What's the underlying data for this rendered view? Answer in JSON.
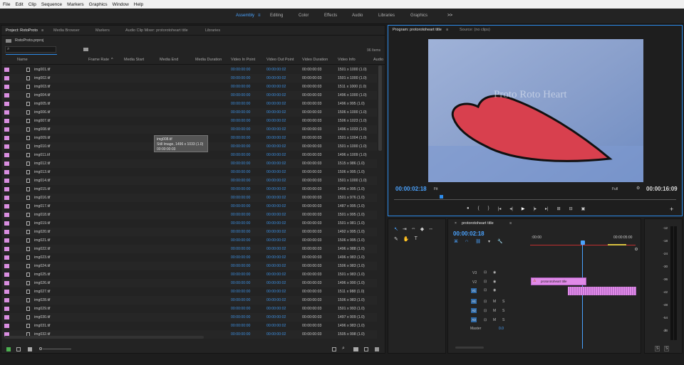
{
  "menu": [
    "File",
    "Edit",
    "Clip",
    "Sequence",
    "Markers",
    "Graphics",
    "Window",
    "Help"
  ],
  "workspaces": [
    "Assembly",
    "Editing",
    "Color",
    "Effects",
    "Audio",
    "Libraries",
    "Graphics"
  ],
  "workspace_more": ">>",
  "project": {
    "tabs": [
      "Project: RotoProto",
      "Media Browser",
      "Markers",
      "Audio Clip Mixer: protorotoheart title",
      "Libraries"
    ],
    "file": "RotoProto.prproj",
    "item_count": "96 Items",
    "columns": [
      "Name",
      "Frame Rate",
      "Media Start",
      "Media End",
      "Media Duration",
      "Video In Point",
      "Video Out Point",
      "Video Duration",
      "Video Info",
      "Audio"
    ],
    "rows": [
      {
        "name": "img001.tif",
        "in": "00:00:00:00",
        "out": "00:00:00:02",
        "dur": "00:00:00:03",
        "info": "1501 x 1000 (1.0)"
      },
      {
        "name": "img002.tif",
        "in": "00:00:00:00",
        "out": "00:00:00:02",
        "dur": "00:00:00:03",
        "info": "1501 x 1000 (1.0)"
      },
      {
        "name": "img003.tif",
        "in": "00:00:00:00",
        "out": "00:00:00:02",
        "dur": "00:00:00:03",
        "info": "1511 x 1000 (1.0)"
      },
      {
        "name": "img004.tif",
        "in": "00:00:00:00",
        "out": "00:00:00:02",
        "dur": "00:00:00:03",
        "info": "1496 x 1000 (1.0)"
      },
      {
        "name": "img005.tif",
        "in": "00:00:00:00",
        "out": "00:00:00:02",
        "dur": "00:00:00:03",
        "info": "1496 x 995 (1.0)"
      },
      {
        "name": "img006.tif",
        "in": "00:00:00:00",
        "out": "00:00:00:02",
        "dur": "00:00:00:03",
        "info": "1506 x 1000 (1.0)"
      },
      {
        "name": "img007.tif",
        "in": "00:00:00:00",
        "out": "00:00:00:02",
        "dur": "00:00:00:03",
        "info": "1506 x 1023 (1.0)"
      },
      {
        "name": "img008.tif",
        "in": "00:00:00:00",
        "out": "00:00:00:02",
        "dur": "00:00:00:03",
        "info": "1496 x 1033 (1.0)"
      },
      {
        "name": "img009.tif",
        "in": "00:00:00:00",
        "out": "00:00:00:02",
        "dur": "00:00:00:03",
        "info": "1501 x 1004 (1.0)"
      },
      {
        "name": "img010.tif",
        "in": "00:00:00:00",
        "out": "00:00:00:02",
        "dur": "00:00:00:03",
        "info": "1501 x 1000 (1.0)"
      },
      {
        "name": "img011.tif",
        "in": "00:00:00:00",
        "out": "00:00:00:02",
        "dur": "00:00:00:03",
        "info": "1496 x 1009 (1.0)"
      },
      {
        "name": "img012.tif",
        "in": "00:00:00:00",
        "out": "00:00:00:02",
        "dur": "00:00:00:03",
        "info": "1515 x 986 (1.0)"
      },
      {
        "name": "img013.tif",
        "in": "00:00:00:00",
        "out": "00:00:00:02",
        "dur": "00:00:00:03",
        "info": "1506 x 995 (1.0)"
      },
      {
        "name": "img014.tif",
        "in": "00:00:00:00",
        "out": "00:00:00:02",
        "dur": "00:00:00:03",
        "info": "1501 x 1000 (1.0)"
      },
      {
        "name": "img015.tif",
        "in": "00:00:00:00",
        "out": "00:00:00:02",
        "dur": "00:00:00:03",
        "info": "1496 x 995 (1.0)"
      },
      {
        "name": "img016.tif",
        "in": "00:00:00:00",
        "out": "00:00:00:02",
        "dur": "00:00:00:03",
        "info": "1501 x 976 (1.0)"
      },
      {
        "name": "img017.tif",
        "in": "00:00:00:00",
        "out": "00:00:00:02",
        "dur": "00:00:00:03",
        "info": "1487 x 995 (1.0)"
      },
      {
        "name": "img018.tif",
        "in": "00:00:00:00",
        "out": "00:00:00:02",
        "dur": "00:00:00:03",
        "info": "1501 x 995 (1.0)"
      },
      {
        "name": "img019.tif",
        "in": "00:00:00:00",
        "out": "00:00:00:02",
        "dur": "00:00:00:03",
        "info": "1501 x 981 (1.0)"
      },
      {
        "name": "img020.tif",
        "in": "00:00:00:00",
        "out": "00:00:00:02",
        "dur": "00:00:00:03",
        "info": "1492 x 995 (1.0)"
      },
      {
        "name": "img021.tif",
        "in": "00:00:00:00",
        "out": "00:00:00:02",
        "dur": "00:00:00:03",
        "info": "1506 x 995 (1.0)"
      },
      {
        "name": "img022.tif",
        "in": "00:00:00:00",
        "out": "00:00:00:02",
        "dur": "00:00:00:03",
        "info": "1496 x 988 (1.0)"
      },
      {
        "name": "img023.tif",
        "in": "00:00:00:00",
        "out": "00:00:00:02",
        "dur": "00:00:00:03",
        "info": "1496 x 983 (1.0)"
      },
      {
        "name": "img024.tif",
        "in": "00:00:00:00",
        "out": "00:00:00:02",
        "dur": "00:00:00:03",
        "info": "1506 x 983 (1.0)"
      },
      {
        "name": "img025.tif",
        "in": "00:00:00:00",
        "out": "00:00:00:02",
        "dur": "00:00:00:03",
        "info": "1501 x 983 (1.0)"
      },
      {
        "name": "img026.tif",
        "in": "00:00:00:00",
        "out": "00:00:00:02",
        "dur": "00:00:00:03",
        "info": "1496 x 990 (1.0)"
      },
      {
        "name": "img027.tif",
        "in": "00:00:00:00",
        "out": "00:00:00:02",
        "dur": "00:00:00:03",
        "info": "1511 x 988 (1.0)"
      },
      {
        "name": "img028.tif",
        "in": "00:00:00:00",
        "out": "00:00:00:02",
        "dur": "00:00:00:03",
        "info": "1506 x 983 (1.0)"
      },
      {
        "name": "img029.tif",
        "in": "00:00:00:00",
        "out": "00:00:00:02",
        "dur": "00:00:00:03",
        "info": "1501 x 993 (1.0)"
      },
      {
        "name": "img030.tif",
        "in": "00:00:00:00",
        "out": "00:00:00:02",
        "dur": "00:00:00:03",
        "info": "1497 x 909 (1.0)"
      },
      {
        "name": "img031.tif",
        "in": "00:00:00:00",
        "out": "00:00:00:02",
        "dur": "00:00:00:03",
        "info": "1496 x 983 (1.0)"
      },
      {
        "name": "img032.tif",
        "in": "00:00:00:00",
        "out": "00:00:00:02",
        "dur": "00:00:00:03",
        "info": "1505 x 998 (1.0)"
      }
    ],
    "tooltip": {
      "line1": "img008.tif",
      "line2": "Still Image, 1496 x 1033 (1.0)",
      "line3": "00:00:00:03"
    }
  },
  "program": {
    "tab_active": "Program: protorotoheart title",
    "tab_other": "Source: (no clips)",
    "overlay_title": "Proto Roto Heart",
    "timecode": "00:00:02:18",
    "fit": "Fit",
    "quality": "Full",
    "duration": "00:00:16:09"
  },
  "timeline": {
    "tab": "protorotoheart title",
    "timecode": "00:00:02:18",
    "ruler_start": ":00:00",
    "ruler_end": "00:00:05:00",
    "clip_label": "protorotoheart title",
    "master": "Master",
    "master_value": "0.0",
    "tracks_video": [
      "V3",
      "V2",
      "V1"
    ],
    "tracks_audio": [
      "A1",
      "A2",
      "A3"
    ]
  },
  "meter": {
    "ticks": [
      "-12",
      "-18",
      "-24",
      "-30",
      "-36",
      "-42",
      "-48",
      "-54",
      "dB"
    ],
    "solo_labels": [
      "S",
      "S"
    ]
  },
  "colors": {
    "accent": "#2d8ceb",
    "clip_pink": "#e08ae8",
    "label_pink": "#d98ee0",
    "playhead": "#4aa3ff"
  }
}
